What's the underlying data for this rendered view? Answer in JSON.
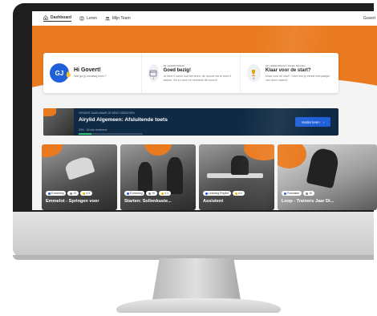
{
  "nav": {
    "items": [
      {
        "label": "Dashboard",
        "icon": "home-icon",
        "active": true
      },
      {
        "label": "Leren",
        "icon": "book-icon",
        "active": false
      },
      {
        "label": "Mijn Team",
        "icon": "team-icon",
        "active": false
      }
    ],
    "user": "Govert"
  },
  "welcome": {
    "initials": "GJ",
    "greeting": "Hi Govert!",
    "subtitle": "Wat ga jij vandaag leren?"
  },
  "leerstreak": {
    "tag": "Je leerstreak",
    "title": "Goed bezig!",
    "text": "Je bent 0 week oud het leren, de record ma te bent 0 weken. Ga zo door en verbreek dit record!",
    "value": "1"
  },
  "challenge": {
    "tag": "Je leerdoelen deze maand",
    "title": "Klaar voor de start?",
    "text": "Klaar voor de start? Start met je eerste leerpaslijst van deze maand!",
    "value": "0"
  },
  "continue": {
    "tag": "Verder gaan waar je bent gebleven",
    "title": "Airylid Algemeen: Afsluitende toets",
    "meta": "20%  · 34 min resterend",
    "progress": 0.2,
    "button": "Verder leren"
  },
  "tiles": [
    {
      "chips": [
        "E-learning",
        "10",
        "4.3"
      ],
      "title": "Emmelot - Springen voor"
    },
    {
      "chips": [
        "E-learning",
        "10",
        "4.1"
      ],
      "title": "Starten: Sollenkuste..."
    },
    {
      "chips": [
        "Learning Playlist",
        "4.0"
      ],
      "title": "Assistent"
    },
    {
      "chips": [
        "Podcaster",
        "10"
      ],
      "title": "Loop - Trainers Jaar Di..."
    }
  ],
  "colors": {
    "accent": "#ea7a1f",
    "primary": "#1f5fd9",
    "banner": "#0f2a44",
    "progress": "#2fbf71"
  }
}
